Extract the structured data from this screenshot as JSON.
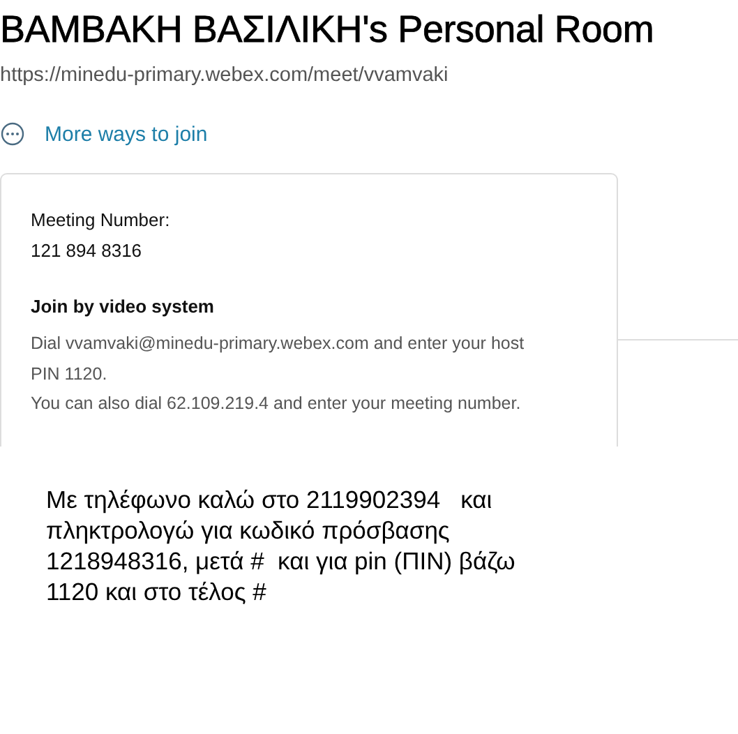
{
  "title": "ΒΑΜΒΑΚΗ ΒΑΣΙΛΙΚΗ's Personal Room",
  "url": "https://minedu-primary.webex.com/meet/vvamvaki",
  "more_ways_link": "More ways to join",
  "card": {
    "meeting_number_label": "Meeting Number:",
    "meeting_number": "121 894 8316",
    "section_heading": "Join by video system",
    "paragraphs": [
      {
        "lines": [
          "Dial vvamvaki@minedu-primary.webex.com and enter your host",
          "PIN 1120."
        ]
      },
      {
        "lines": [
          "You can also dial 62.109.219.4 and enter your meeting number."
        ]
      }
    ]
  },
  "note": {
    "lines": [
      "Με τηλέφωνο καλώ στο 2119902394   και",
      "πληκτρολογώ για κωδικό πρόσβασης",
      "1218948316, μετά #  και για pin (ΠΙΝ) βάζω",
      "1120 και στο τέλος #"
    ]
  }
}
